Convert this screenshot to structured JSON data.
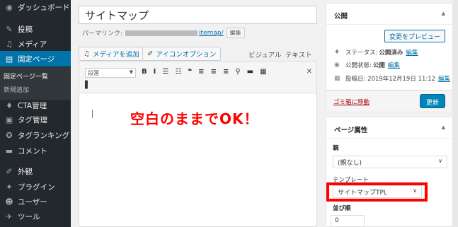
{
  "sidebar": {
    "items": [
      {
        "label": "ダッシュボード",
        "icon": "dashboard-icon",
        "glyph": "◉"
      },
      {
        "label": "投稿",
        "icon": "pin-icon",
        "glyph": "✎"
      },
      {
        "label": "メディア",
        "icon": "media-icon",
        "glyph": "♫"
      },
      {
        "label": "固定ページ",
        "icon": "page-icon",
        "glyph": "▤"
      },
      {
        "label": "CTA管理",
        "icon": "lightbulb-icon",
        "glyph": "♦"
      },
      {
        "label": "タグ管理",
        "icon": "tag-box-icon",
        "glyph": "▣"
      },
      {
        "label": "タグランキング",
        "icon": "award-icon",
        "glyph": "✪"
      },
      {
        "label": "コメント",
        "icon": "comment-icon",
        "glyph": "▬"
      },
      {
        "label": "外観",
        "icon": "brush-icon",
        "glyph": "✐"
      },
      {
        "label": "プラグイン",
        "icon": "plugin-icon",
        "glyph": "✦"
      },
      {
        "label": "ユーザー",
        "icon": "user-icon",
        "glyph": "☻"
      },
      {
        "label": "ツール",
        "icon": "wrench-icon",
        "glyph": "✈"
      }
    ],
    "submenu": [
      "固定ページ一覧",
      "新規追加"
    ]
  },
  "editor": {
    "title_value": "サイトマップ",
    "permalink_label": "パーマリンク:",
    "permalink_slug": "itemap/",
    "permalink_edit": "編集",
    "add_media": "メディアを追加",
    "icon_option": "アイコンオプション",
    "tab_visual": "ビジュアル",
    "tab_text": "テキスト",
    "format_value": "段落",
    "toolbar_icons": [
      "B",
      "I",
      "☰",
      "☷",
      "❝",
      "≡",
      "≡",
      "≡",
      "⚲",
      "▬",
      "▦"
    ],
    "expand_icon": "✕",
    "row2_icon": "▌",
    "annotation": "空白のままでOK！"
  },
  "publish": {
    "title": "公開",
    "preview": "変更をプレビュー",
    "status_label": "ステータス:",
    "status_value": "公開済み",
    "visibility_label": "公開状態:",
    "visibility_value": "公開",
    "date_text": "投稿日: 2019年12月19日 11:12",
    "edit": "編集",
    "trash": "ゴミ箱に移動",
    "update": "更新"
  },
  "attributes": {
    "title": "ページ属性",
    "parent_label": "親",
    "parent_value": "(親なし)",
    "template_label": "テンプレート",
    "template_value": "サイトマップTPL",
    "order_label": "並び順",
    "order_value": "0"
  },
  "colors": {
    "accent": "#0073aa",
    "highlight": "#ff0000",
    "sidebar": "#23282d",
    "active": "#0073aa"
  }
}
